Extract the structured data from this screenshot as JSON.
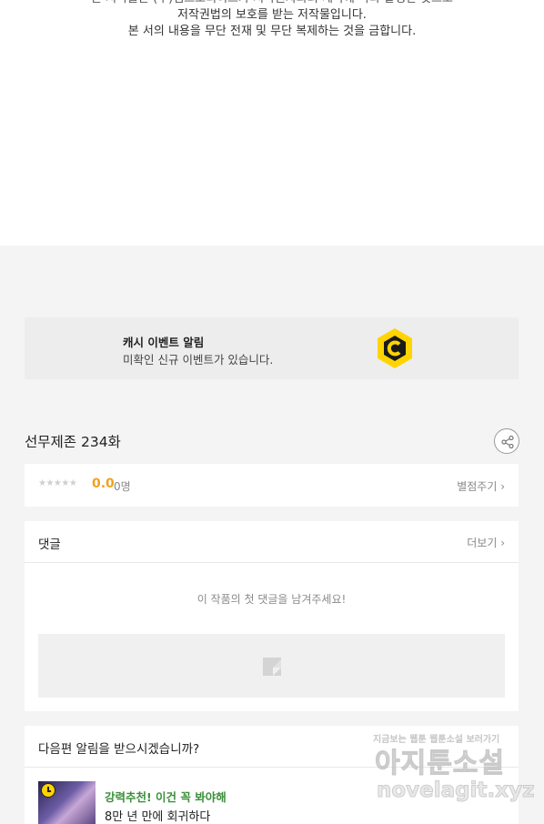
{
  "copyright": {
    "line1": "본 저작물은 (주)엠스토리허브가 저작권자와의 계약에 따라 발행한 것으로",
    "line2": "저작권법의 보호를 받는 저작물입니다.",
    "line3": "본 서의 내용을 무단 전재 및 무단 복제하는 것을 금합니다."
  },
  "cash_event": {
    "title": "캐시 이벤트 알림",
    "desc": "미확인 신규 이벤트가 있습니다.",
    "logo_icon": "cash-c-logo",
    "logo_color": "#ffd400"
  },
  "episode": {
    "title": "선무제존 234화",
    "share_icon": "share-icon"
  },
  "rating": {
    "stars": "★★★★★",
    "score": "0.0",
    "count": "0명",
    "rate_link": "별점주기 ›"
  },
  "comments": {
    "title": "댓글",
    "more": "더보기 ›",
    "empty": "이 작품의 첫 댓글을 남겨주세요!"
  },
  "next_alert": {
    "title": "다음편 알림을 받으시겠습니까?",
    "label": "강력추천! 이건 꼭 봐야해",
    "name": "8만 년 만에 회귀하다"
  },
  "watermark": {
    "top": "지금보는 웹툰 웹툰소설 보러가기",
    "big": "아지툰소설",
    "url": "novelagit.xyz"
  }
}
